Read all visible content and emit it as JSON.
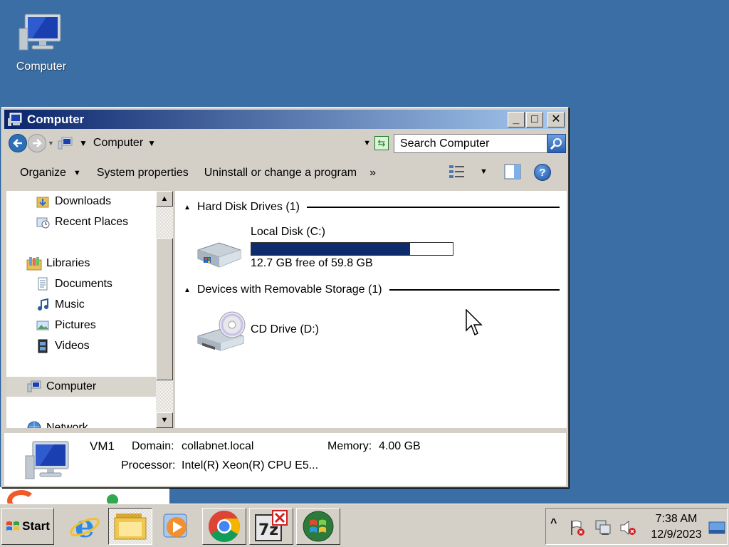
{
  "desktop": {
    "icon_label": "Computer"
  },
  "window": {
    "title": "Computer",
    "buttons": {
      "minimize": "_",
      "maximize": "□",
      "close": "✕"
    },
    "address": {
      "crumb": "Computer"
    },
    "search": {
      "placeholder": "Search Computer"
    },
    "toolbar": {
      "organize": "Organize",
      "system_properties": "System properties",
      "uninstall": "Uninstall or change a program",
      "more": "»"
    },
    "nav": [
      {
        "label": "Downloads"
      },
      {
        "label": "Recent Places"
      },
      {
        "label": "Libraries"
      },
      {
        "label": "Documents"
      },
      {
        "label": "Music"
      },
      {
        "label": "Pictures"
      },
      {
        "label": "Videos"
      },
      {
        "label": "Computer"
      },
      {
        "label": "Network"
      }
    ],
    "groups": {
      "hdd": {
        "heading": "Hard Disk Drives (1)"
      },
      "removable": {
        "heading": "Devices with Removable Storage (1)"
      }
    },
    "drives": {
      "c": {
        "name": "Local Disk (C:)",
        "space": "12.7 GB free of 59.8 GB",
        "used_fraction": 0.788
      },
      "d": {
        "name": "CD Drive (D:)"
      }
    },
    "details": {
      "computer_name": "VM1",
      "domain_label": "Domain:",
      "domain_value": "collabnet.local",
      "memory_label": "Memory:",
      "memory_value": "4.00 GB",
      "processor_label": "Processor:",
      "processor_value": "Intel(R) Xeon(R) CPU E5..."
    }
  },
  "taskbar": {
    "start_label": "Start",
    "tray_expand": "^",
    "clock_time": "7:38 AM",
    "clock_date": "12/9/2023"
  },
  "colors": {
    "desktop": "#3a6ea5",
    "title_start": "#0a246a",
    "title_end": "#a6caf0",
    "disk_fill": "#0e2b6b"
  }
}
